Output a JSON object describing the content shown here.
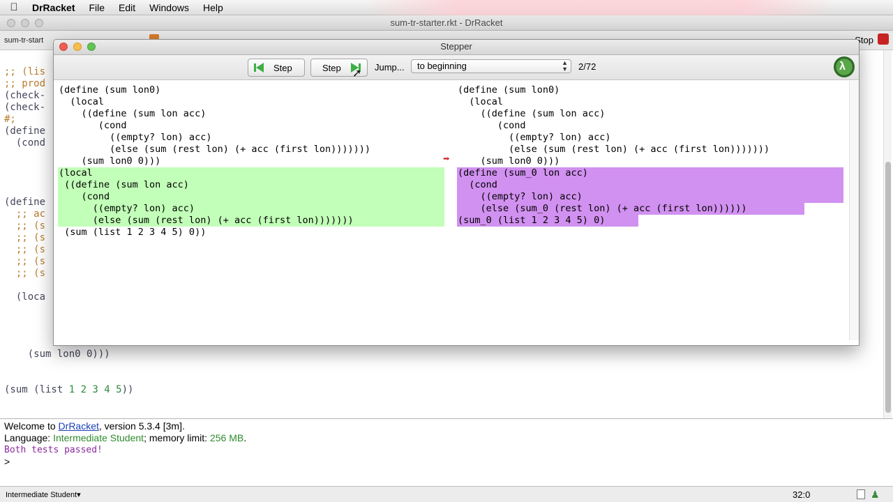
{
  "menubar": {
    "apple": "",
    "app_name": "DrRacket",
    "items": [
      "File",
      "Edit",
      "Windows",
      "Help"
    ]
  },
  "main_window": {
    "title": "sum-tr-starter.rkt - DrRacket",
    "file_tab": "sum-tr-start",
    "stop_label": "Stop"
  },
  "definitions": {
    "lines": [
      {
        "text": ";; (lis",
        "cls": "cm"
      },
      {
        "text": ";; prod",
        "cls": "cm"
      },
      {
        "text": "(check-",
        "cls": "pn"
      },
      {
        "text": "(check-",
        "cls": "pn"
      },
      {
        "text": "#;",
        "cls": "cm"
      },
      {
        "text": "(define",
        "cls": "pn"
      },
      {
        "text": "  (cond",
        "cls": "pn"
      },
      {
        "text": "(define",
        "cls": "pn"
      },
      {
        "text": "  ;; ac",
        "cls": "cm"
      },
      {
        "text": "  ;; (s",
        "cls": "cm"
      },
      {
        "text": "  ;; (s",
        "cls": "cm"
      },
      {
        "text": "  ;; (s",
        "cls": "cm"
      },
      {
        "text": "  ;; (s",
        "cls": "cm"
      },
      {
        "text": "  ;; (s",
        "cls": "cm"
      },
      {
        "text": "  (loca",
        "cls": "pn"
      },
      {
        "text": "    (sum lon0 0)))",
        "cls": "pn"
      }
    ],
    "sum_expr": {
      "open": "(sum (list ",
      "nums": "1 2 3 4 5",
      "close": "))"
    }
  },
  "interactions": {
    "welcome_prefix": "Welcome to ",
    "welcome_link": "DrRacket",
    "welcome_suffix": ", version 5.3.4 [3m].",
    "language_prefix": "Language: ",
    "language_name": "Intermediate Student",
    "memory_prefix": "; memory limit: ",
    "memory_value": "256 MB",
    "memory_suffix": ".",
    "tests_result": "Both tests passed!",
    "prompt": ">"
  },
  "statusbar": {
    "language": "Intermediate Student▾",
    "position": "32:0"
  },
  "stepper": {
    "title": "Stepper",
    "back_label": "Step",
    "forward_label": "Step",
    "jump_label": "Jump...",
    "jump_value": "to beginning",
    "jump_chevron": "▲▼",
    "step_count": "2/72",
    "left_lines": [
      "(define (sum lon0)",
      "  (local",
      "    ((define (sum lon acc)",
      "       (cond",
      "         ((empty? lon) acc)",
      "         (else (sum (rest lon) (+ acc (first lon)))))))",
      "    (sum lon0 0)))",
      "(local",
      " ((define (sum lon acc)",
      "    (cond",
      "      ((empty? lon) acc)",
      "      (else (sum (rest lon) (+ acc (first lon)))))))",
      " (sum (list 1 2 3 4 5) 0))"
    ],
    "right_lines": [
      "(define (sum lon0)",
      "  (local",
      "    ((define (sum lon acc)",
      "       (cond",
      "         ((empty? lon) acc)",
      "         (else (sum (rest lon) (+ acc (first lon)))))))",
      "    (sum lon0 0)))",
      "(define (sum_0 lon acc)",
      "  (cond",
      "    ((empty? lon) acc)",
      "    (else (sum_0 (rest lon) (+ acc (first lon))))))",
      "(sum_0 (list 1 2 3 4 5) 0)"
    ],
    "arrow": "➡"
  },
  "colors": {
    "reduct_left": "#c2ffb8",
    "reduct_right": "#d191f0",
    "comment": "#b97a2a",
    "number": "#2b8b3a",
    "test_output": "#8a2a9e"
  }
}
